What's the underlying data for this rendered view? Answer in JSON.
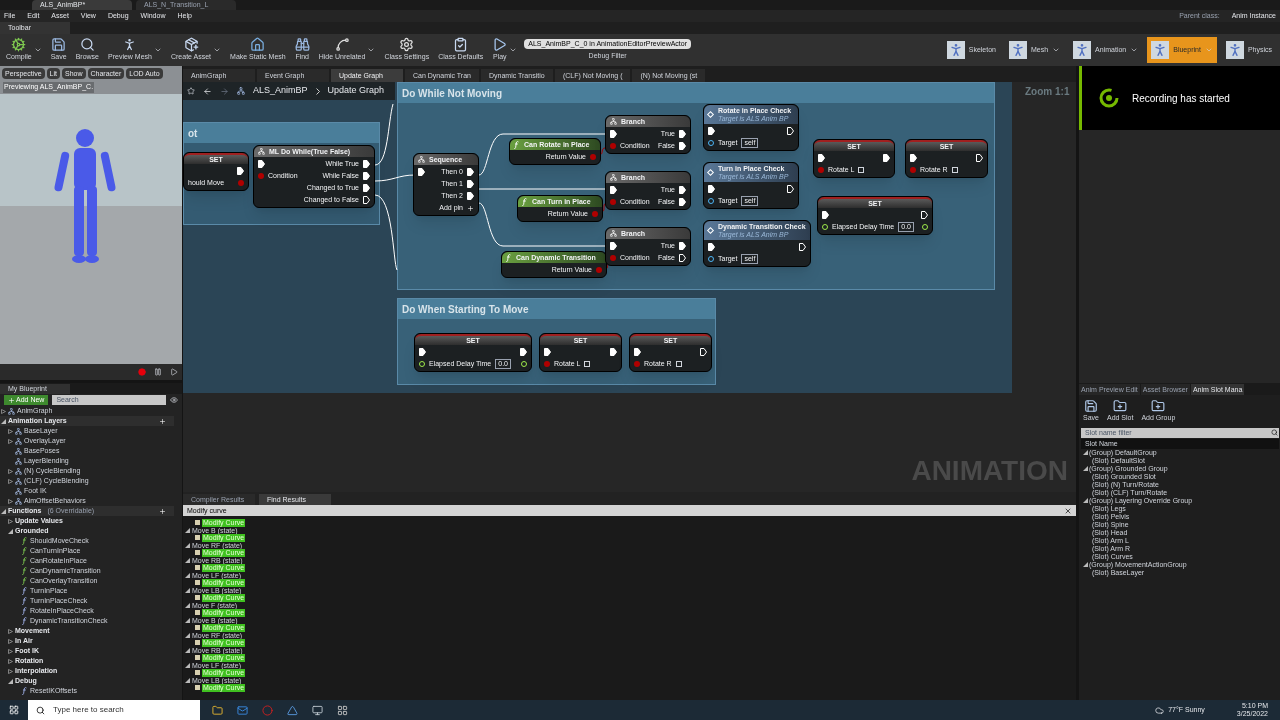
{
  "window": {
    "tabs": [
      {
        "label": "ALS_AnimBP*",
        "selected": true
      },
      {
        "label": "ALS_N_Transition_L",
        "selected": false
      }
    ],
    "menu": [
      "File",
      "Edit",
      "Asset",
      "View",
      "Debug",
      "Window",
      "Help"
    ],
    "parent_class_label": "Parent class:",
    "parent_class": "Anim Instance"
  },
  "toolbar": {
    "tab": "Toolbar",
    "buttons": [
      {
        "label": "Compile",
        "dropdown": true
      },
      {
        "label": "Save",
        "dropdown": false
      },
      {
        "label": "Browse",
        "dropdown": false
      },
      {
        "label": "Preview Mesh",
        "dropdown": true
      },
      {
        "label": "Create Asset",
        "dropdown": true
      },
      {
        "label": "Make Static Mesh",
        "dropdown": false
      },
      {
        "label": "Find",
        "dropdown": false
      },
      {
        "label": "Hide Unrelated",
        "dropdown": true
      },
      {
        "label": "Class Settings",
        "dropdown": false
      },
      {
        "label": "Class Defaults",
        "dropdown": false
      },
      {
        "label": "Play",
        "dropdown": true
      }
    ],
    "debug_filter": {
      "value": "ALS_AnimBP_C_0 in AnimationEditorPreviewActor",
      "label": "Debug Filter"
    },
    "modes": [
      {
        "label": "Skeleton",
        "selected": false,
        "dropdown": false
      },
      {
        "label": "Mesh",
        "selected": false,
        "dropdown": true
      },
      {
        "label": "Animation",
        "selected": false,
        "dropdown": true
      },
      {
        "label": "Blueprint",
        "selected": true,
        "dropdown": true
      },
      {
        "label": "Physics",
        "selected": false,
        "dropdown": false
      }
    ]
  },
  "viewport": {
    "buttons": [
      "Perspective",
      "Lit",
      "Show",
      "Character",
      "LOD Auto"
    ],
    "caption": "Previewing ALS_AnimBP_C."
  },
  "my_blueprint": {
    "tab": "My Blueprint",
    "add_button": "Add New",
    "search_placeholder": "Search",
    "sections": [
      {
        "label": "AnimGraph",
        "kind": "item",
        "expanded": false
      },
      {
        "label": "Animation Layers",
        "kind": "section",
        "expanded": true,
        "children": [
          {
            "label": "BaseLayer",
            "expanded": false
          },
          {
            "label": "OverlayLayer",
            "expanded": false
          },
          {
            "label": "BasePoses"
          },
          {
            "label": "LayerBlending"
          },
          {
            "label": "(N) CycleBlending",
            "expanded": false
          },
          {
            "label": "(CLF) CycleBlending",
            "expanded": false
          },
          {
            "label": "Foot IK"
          },
          {
            "label": "AimOffsetBehaviors",
            "expanded": false
          }
        ]
      },
      {
        "label": "Functions",
        "note": "(6 Overridable)",
        "kind": "section",
        "expanded": true,
        "children": [
          {
            "label": "Update Values",
            "kind": "category",
            "expanded": false
          },
          {
            "label": "Grounded",
            "kind": "category",
            "expanded": true,
            "children": [
              {
                "label": "ShouldMoveCheck",
                "pure": true
              },
              {
                "label": "CanTurnInPlace",
                "pure": true
              },
              {
                "label": "CanRotateInPlace",
                "pure": true
              },
              {
                "label": "CanDynamicTransition",
                "pure": true
              },
              {
                "label": "CanOverlayTransition",
                "pure": true
              },
              {
                "label": "TurnInPlace",
                "pure": false
              },
              {
                "label": "TurnInPlaceCheck",
                "pure": false
              },
              {
                "label": "RotateInPlaceCheck",
                "pure": false
              },
              {
                "label": "DynamicTransitionCheck",
                "pure": false
              }
            ]
          },
          {
            "label": "Movement",
            "kind": "category",
            "expanded": false
          },
          {
            "label": "In Air",
            "kind": "category",
            "expanded": false
          },
          {
            "label": "Foot IK",
            "kind": "category",
            "expanded": false
          },
          {
            "label": "Rotation",
            "kind": "category",
            "expanded": false
          },
          {
            "label": "Interpolation",
            "kind": "category",
            "expanded": false
          },
          {
            "label": "Debug",
            "kind": "category",
            "expanded": true,
            "children": [
              {
                "label": "ResetIKOffsets",
                "pure": false
              }
            ]
          }
        ]
      }
    ]
  },
  "graph": {
    "tabs": [
      {
        "label": "AnimGraph",
        "selected": false
      },
      {
        "label": "Event Graph",
        "selected": false
      },
      {
        "label": "Update Graph",
        "selected": true
      },
      {
        "label": "Can Dynamic Tran",
        "selected": false
      },
      {
        "label": "Dynamic Transitio",
        "selected": false
      },
      {
        "label": "(CLF) Not Moving (",
        "selected": false
      },
      {
        "label": "(N) Not Moving (st",
        "selected": false
      }
    ],
    "breadcrumb": [
      "ALS_AnimBP",
      "Update Graph"
    ],
    "zoom": "Zoom 1:1",
    "watermark": "ANIMATION",
    "comments": [
      {
        "title": "ot"
      },
      {
        "title": "Do While Not Moving"
      },
      {
        "title": "Do When Starting To Move"
      }
    ],
    "nodes": [
      {
        "kind": "set",
        "title": "SET",
        "rows": [
          {
            "out": {
              "kind": "exec",
              "linked": true
            }
          },
          {
            "text": "hould Move",
            "out": {
              "kind": "bool"
            }
          }
        ]
      },
      {
        "kind": "flow",
        "title": "ML Do While(True False)",
        "rows": [
          {
            "in": {
              "kind": "exec",
              "linked": true
            },
            "out": {
              "kind": "exec",
              "label": "While True",
              "linked": true
            }
          },
          {
            "in": {
              "kind": "bool",
              "label": "Condition"
            },
            "out": {
              "kind": "exec",
              "label": "While False",
              "linked": true
            }
          },
          {
            "out": {
              "kind": "exec",
              "label": "Changed to True",
              "linked": true
            }
          },
          {
            "out": {
              "kind": "exec",
              "label": "Changed to False",
              "linked": false
            }
          }
        ]
      },
      {
        "kind": "flow",
        "title": "Sequence",
        "rows": [
          {
            "in": {
              "kind": "exec",
              "linked": true
            },
            "out": {
              "kind": "exec",
              "label": "Then 0",
              "linked": true
            }
          },
          {
            "out": {
              "kind": "exec",
              "label": "Then 1",
              "linked": true
            }
          },
          {
            "out": {
              "kind": "exec",
              "label": "Then 2",
              "linked": true
            }
          },
          {
            "out": {
              "kind": "add",
              "label": "Add pin"
            }
          }
        ]
      },
      {
        "kind": "pure",
        "title": "Can Rotate in Place",
        "rows": [
          {
            "out": {
              "kind": "bool",
              "label": "Return Value"
            }
          }
        ]
      },
      {
        "kind": "pure",
        "title": "Can Turn in Place",
        "rows": [
          {
            "out": {
              "kind": "bool",
              "label": "Return Value"
            }
          }
        ]
      },
      {
        "kind": "pure",
        "title": "Can Dynamic Transition",
        "rows": [
          {
            "out": {
              "kind": "bool",
              "label": "Return Value"
            }
          }
        ]
      },
      {
        "kind": "flow",
        "title": "Branch",
        "rows": [
          {
            "in": {
              "kind": "exec",
              "linked": true
            },
            "out": {
              "kind": "exec",
              "label": "True",
              "linked": true
            }
          },
          {
            "in": {
              "kind": "bool",
              "label": "Condition"
            },
            "out": {
              "kind": "exec",
              "label": "False",
              "linked": true
            }
          }
        ]
      },
      {
        "kind": "flow",
        "title": "Branch",
        "rows": [
          {
            "in": {
              "kind": "exec",
              "linked": true
            },
            "out": {
              "kind": "exec",
              "label": "True",
              "linked": true
            }
          },
          {
            "in": {
              "kind": "bool",
              "label": "Condition"
            },
            "out": {
              "kind": "exec",
              "label": "False",
              "linked": true
            }
          }
        ]
      },
      {
        "kind": "flow",
        "title": "Branch",
        "rows": [
          {
            "in": {
              "kind": "exec",
              "linked": true
            },
            "out": {
              "kind": "exec",
              "label": "True",
              "linked": true
            }
          },
          {
            "in": {
              "kind": "bool",
              "label": "Condition"
            },
            "out": {
              "kind": "exec",
              "label": "False",
              "linked": false
            }
          }
        ]
      },
      {
        "kind": "call",
        "title": "Rotate in Place Check",
        "subtitle": "Target is ALS Anim BP",
        "rows": [
          {
            "in": {
              "kind": "exec",
              "linked": true
            },
            "out": {
              "kind": "exec",
              "linked": false
            }
          },
          {
            "in": {
              "kind": "object",
              "label": "Target",
              "value": "self"
            }
          }
        ]
      },
      {
        "kind": "call",
        "title": "Turn in Place Check",
        "subtitle": "Target is ALS Anim BP",
        "rows": [
          {
            "in": {
              "kind": "exec",
              "linked": true
            },
            "out": {
              "kind": "exec",
              "linked": false
            }
          },
          {
            "in": {
              "kind": "object",
              "label": "Target",
              "value": "self"
            }
          }
        ]
      },
      {
        "kind": "call",
        "title": "Dynamic Transition Check",
        "subtitle": "Target is ALS Anim BP",
        "rows": [
          {
            "in": {
              "kind": "exec",
              "linked": true
            },
            "out": {
              "kind": "exec",
              "linked": false
            }
          },
          {
            "in": {
              "kind": "object",
              "label": "Target",
              "value": "self"
            }
          }
        ]
      },
      {
        "kind": "set",
        "title": "SET",
        "rows": [
          {
            "in": {
              "kind": "exec",
              "linked": true
            },
            "out": {
              "kind": "exec",
              "linked": true
            }
          },
          {
            "in": {
              "kind": "bool",
              "label": "Rotate L",
              "checked": false
            }
          }
        ]
      },
      {
        "kind": "set",
        "title": "SET",
        "rows": [
          {
            "in": {
              "kind": "exec",
              "linked": true
            },
            "out": {
              "kind": "exec",
              "linked": false
            }
          },
          {
            "in": {
              "kind": "bool",
              "label": "Rotate R",
              "checked": false
            }
          }
        ]
      },
      {
        "kind": "set",
        "title": "SET",
        "rows": [
          {
            "in": {
              "kind": "exec",
              "linked": true
            },
            "out": {
              "kind": "exec",
              "linked": false
            }
          },
          {
            "in": {
              "kind": "float",
              "label": "Elapsed Delay Time",
              "value": "0.0"
            },
            "out": {
              "kind": "float"
            }
          }
        ]
      },
      {
        "kind": "set",
        "title": "SET",
        "rows": [
          {
            "in": {
              "kind": "exec",
              "linked": true
            },
            "out": {
              "kind": "exec",
              "linked": true
            }
          },
          {
            "in": {
              "kind": "float",
              "label": "Elapsed Delay Time",
              "value": "0.0"
            },
            "out": {
              "kind": "float"
            }
          }
        ]
      },
      {
        "kind": "set",
        "title": "SET",
        "rows": [
          {
            "in": {
              "kind": "exec",
              "linked": true
            },
            "out": {
              "kind": "exec",
              "linked": true
            }
          },
          {
            "in": {
              "kind": "bool",
              "label": "Rotate L",
              "checked": false
            }
          }
        ]
      },
      {
        "kind": "set",
        "title": "SET",
        "rows": [
          {
            "in": {
              "kind": "exec",
              "linked": true
            },
            "out": {
              "kind": "exec",
              "linked": false
            }
          },
          {
            "in": {
              "kind": "bool",
              "label": "Rotate R",
              "checked": false
            }
          }
        ]
      }
    ]
  },
  "results": {
    "tabs": [
      {
        "label": "Compiler Results",
        "selected": false
      },
      {
        "label": "Find Results",
        "selected": true
      }
    ],
    "search": "Modify curve",
    "rows": [
      {
        "children": [
          "Modify Curve"
        ]
      },
      {
        "label": "Move B (state)",
        "children": [
          "Modify Curve"
        ]
      },
      {
        "label": "Move RF (state)",
        "children": [
          "Modify Curve"
        ]
      },
      {
        "label": "Move RB (state)",
        "children": [
          "Modify Curve"
        ]
      },
      {
        "label": "Move LF (state)",
        "children": [
          "Modify Curve"
        ]
      },
      {
        "label": "Move LB (state)",
        "children": [
          "Modify Curve"
        ]
      },
      {
        "label": "Move F (state)",
        "children": [
          "Modify Curve"
        ]
      },
      {
        "label": "Move B (state)",
        "children": [
          "Modify Curve"
        ]
      },
      {
        "label": "Move RF (state)",
        "children": [
          "Modify Curve"
        ]
      },
      {
        "label": "Move RB (state)",
        "children": [
          "Modify Curve"
        ]
      },
      {
        "label": "Move LF (state)",
        "children": [
          "Modify Curve"
        ]
      },
      {
        "label": "Move LB (state)",
        "children": [
          "Modify Curve"
        ]
      }
    ]
  },
  "notification": "Recording has started",
  "slot_manager": {
    "tabs": [
      {
        "label": "Anim Preview Edit",
        "selected": false
      },
      {
        "label": "Asset Browser",
        "selected": false
      },
      {
        "label": "Anim Slot Mana",
        "selected": true
      }
    ],
    "buttons": [
      "Save",
      "Add Slot",
      "Add Group"
    ],
    "filter_placeholder": "Slot name filter",
    "column": "Slot Name",
    "groups": [
      {
        "label": "(Group) DefaultGroup",
        "children": [
          "(Slot) DefaultSlot"
        ]
      },
      {
        "label": "(Group) Grounded Group",
        "children": [
          "(Slot) Grounded Slot",
          "(Slot) (N) Turn/Rotate",
          "(Slot) (CLF) Turn/Rotate"
        ]
      },
      {
        "label": "(Group) Layering Override Group",
        "children": [
          "(Slot) Legs",
          "(Slot) Pelvis",
          "(Slot) Spine",
          "(Slot) Head",
          "(Slot) Arm L",
          "(Slot) Arm R",
          "(Slot) Curves"
        ]
      },
      {
        "label": "(Group) MovementActionGroup",
        "children": [
          "(Slot) BaseLayer"
        ]
      }
    ]
  },
  "taskbar": {
    "search_placeholder": "Type here to search",
    "weather": "77°F Sunny",
    "time": "5:10 PM",
    "date": "3/25/2022"
  }
}
